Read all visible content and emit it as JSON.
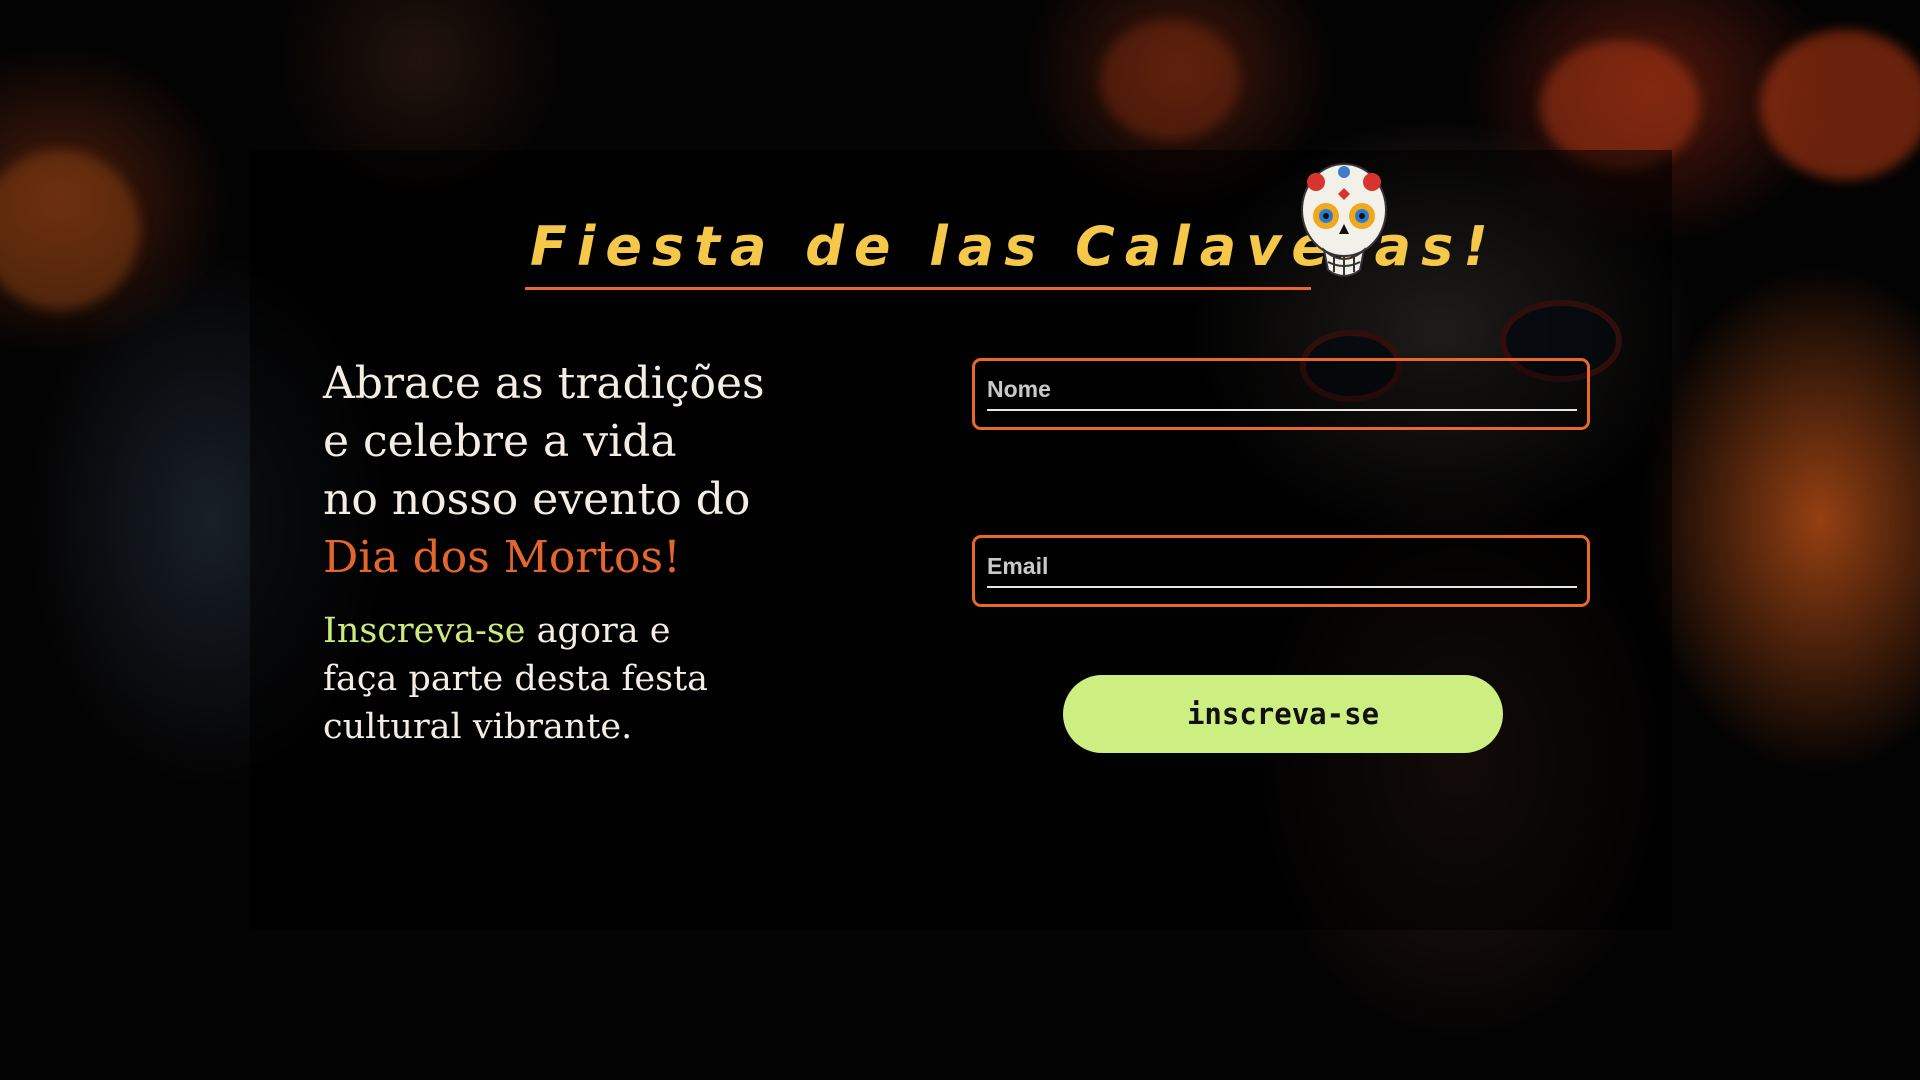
{
  "header": {
    "title": "Fiesta de las Calaveras!",
    "skull_icon": "sugar-skull-icon"
  },
  "intro": {
    "headline_lines": [
      "Abrace as tradições",
      "e celebre a vida",
      "no nosso evento do"
    ],
    "headline_accent": "Dia dos Mortos!",
    "sub_highlight": "Inscreva-se",
    "sub_line1_rest": " agora e",
    "sub_line2": "faça parte desta festa",
    "sub_line3": "cultural vibrante."
  },
  "form": {
    "name_placeholder": "Nome",
    "email_placeholder": "Email",
    "submit_label": "inscreva-se"
  },
  "colors": {
    "title": "#f6c84a",
    "accent_orange": "#e8682b",
    "accent_green": "#cdeb7c",
    "button_bg": "#cdef82",
    "text": "#f4ede3"
  }
}
